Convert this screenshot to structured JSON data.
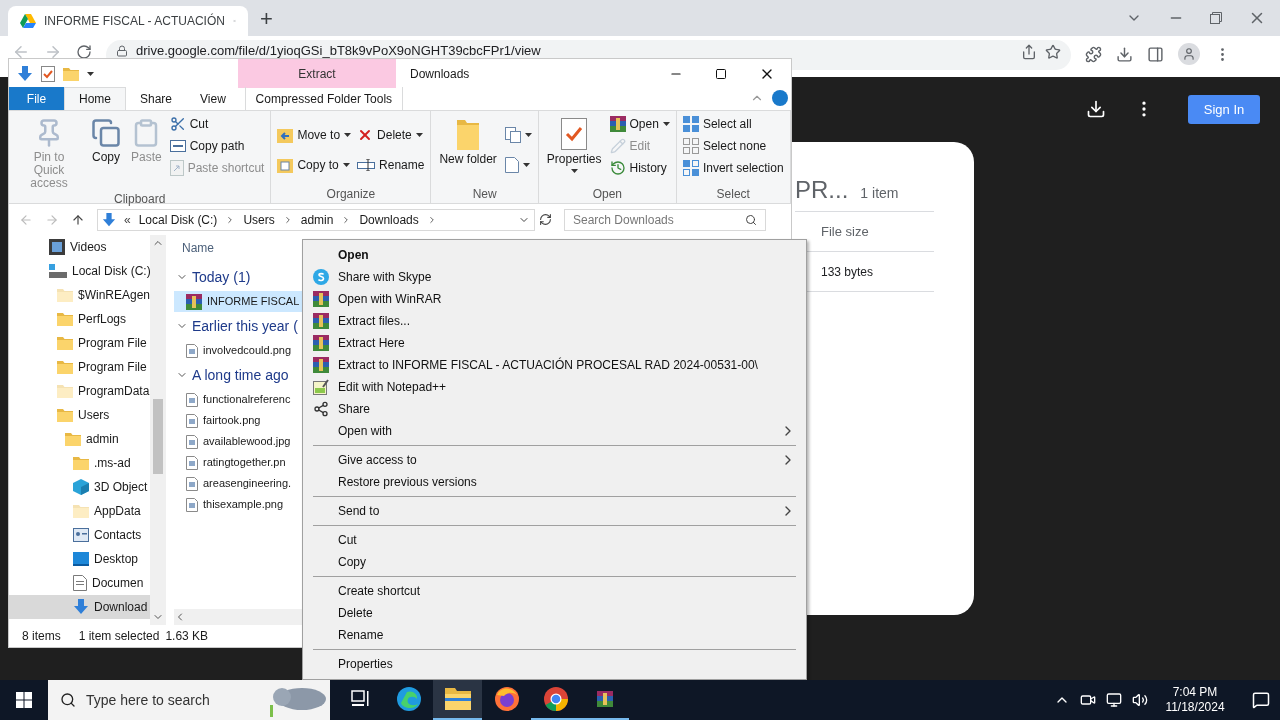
{
  "browser": {
    "tab_title": "INFORME FISCAL - ACTUACIÓN",
    "new_tab": "+",
    "url": "drive.google.com/file/d/1yioqGSi_bT8k9vPoX9oNGHT39cbcFPr1/view",
    "sign_in": "Sign In"
  },
  "drive_card": {
    "title": "PR...",
    "count": "1 item",
    "column": "File size",
    "value": "133 bytes"
  },
  "explorer": {
    "contextual_group": "Extract",
    "title": "Downloads",
    "ribbon_tabs": [
      {
        "label": "File",
        "kind": "file",
        "selected": false
      },
      {
        "label": "Home",
        "kind": "tab",
        "selected": true
      },
      {
        "label": "Share",
        "kind": "tab",
        "selected": false
      },
      {
        "label": "View",
        "kind": "tab",
        "selected": false
      },
      {
        "label": "Compressed Folder Tools",
        "kind": "contextual",
        "selected": false
      }
    ],
    "ribbon_groups": [
      {
        "label": "Clipboard",
        "columns": [
          {
            "kind": "large",
            "items": [
              {
                "label": "Pin to Quick access",
                "disabled": true,
                "dropdown": false
              }
            ]
          },
          {
            "kind": "large",
            "items": [
              {
                "label": "Copy",
                "disabled": false,
                "dropdown": false
              }
            ]
          },
          {
            "kind": "large",
            "items": [
              {
                "label": "Paste",
                "disabled": true,
                "dropdown": false
              }
            ]
          },
          {
            "kind": "stack",
            "items": [
              {
                "label": "Cut",
                "disabled": false,
                "dropdown": false
              },
              {
                "label": "Copy path",
                "disabled": false,
                "dropdown": false
              },
              {
                "label": "Paste shortcut",
                "disabled": true,
                "dropdown": false
              }
            ]
          }
        ]
      },
      {
        "label": "Organize",
        "columns": [
          {
            "kind": "stack",
            "items": [
              {
                "label": "Move to",
                "disabled": false,
                "dropdown": true
              },
              {
                "label": "Copy to",
                "disabled": false,
                "dropdown": true
              }
            ]
          },
          {
            "kind": "stack",
            "items": [
              {
                "label": "Delete",
                "disabled": false,
                "dropdown": true
              },
              {
                "label": "Rename",
                "disabled": false,
                "dropdown": false
              }
            ]
          }
        ]
      },
      {
        "label": "New",
        "columns": [
          {
            "kind": "large",
            "items": [
              {
                "label": "New folder",
                "disabled": false,
                "dropdown": false
              }
            ]
          },
          {
            "kind": "stack",
            "items": [
              {
                "disabled": false,
                "dropdown": true
              },
              {
                "disabled": false,
                "dropdown": true
              }
            ]
          }
        ]
      },
      {
        "label": "Open",
        "columns": [
          {
            "kind": "large",
            "items": [
              {
                "label": "Properties",
                "disabled": false,
                "dropdown": true
              }
            ]
          },
          {
            "kind": "stack",
            "items": [
              {
                "label": "Open",
                "disabled": false,
                "dropdown": true
              },
              {
                "label": "Edit",
                "disabled": true,
                "dropdown": false
              },
              {
                "label": "History",
                "disabled": false,
                "dropdown": false
              }
            ]
          }
        ]
      },
      {
        "label": "Select",
        "columns": [
          {
            "kind": "stack",
            "items": [
              {
                "label": "Select all",
                "disabled": false,
                "dropdown": false
              },
              {
                "label": "Select none",
                "disabled": false,
                "dropdown": false
              },
              {
                "label": "Invert selection",
                "disabled": false,
                "dropdown": false
              }
            ]
          }
        ]
      }
    ],
    "address": {
      "overflow": "«",
      "crumbs": [
        "Local Disk (C:)",
        "Users",
        "admin",
        "Downloads"
      ],
      "search_placeholder": "Search Downloads"
    },
    "nav": [
      {
        "label": "Videos",
        "kind": "videos",
        "hidden": false,
        "selected": false
      },
      {
        "label": "Local Disk (C:)",
        "kind": "drive",
        "hidden": false,
        "selected": false,
        "children": [
          {
            "label": "$WinREAgen",
            "kind": "folder",
            "hidden": true,
            "selected": false
          },
          {
            "label": "PerfLogs",
            "kind": "folder",
            "hidden": false,
            "selected": false
          },
          {
            "label": "Program File",
            "kind": "folder",
            "hidden": false,
            "selected": false
          },
          {
            "label": "Program File",
            "kind": "folder",
            "hidden": false,
            "selected": false
          },
          {
            "label": "ProgramData",
            "kind": "folder",
            "hidden": true,
            "selected": false
          },
          {
            "label": "Users",
            "kind": "folder",
            "hidden": false,
            "selected": false,
            "children": [
              {
                "label": "admin",
                "kind": "folder",
                "hidden": false,
                "selected": false,
                "children": [
                  {
                    "label": ".ms-ad",
                    "kind": "folder",
                    "hidden": false,
                    "selected": false
                  },
                  {
                    "label": "3D Object",
                    "kind": "cube",
                    "hidden": false,
                    "selected": false
                  },
                  {
                    "label": "AppData",
                    "kind": "folder",
                    "hidden": true,
                    "selected": false
                  },
                  {
                    "label": "Contacts",
                    "kind": "contacts",
                    "hidden": false,
                    "selected": false
                  },
                  {
                    "label": "Desktop",
                    "kind": "desktop",
                    "hidden": false,
                    "selected": false
                  },
                  {
                    "label": "Documen",
                    "kind": "documents",
                    "hidden": false,
                    "selected": false
                  },
                  {
                    "label": "Download",
                    "kind": "downloads",
                    "hidden": false,
                    "selected": true
                  }
                ]
              }
            ]
          }
        ]
      }
    ],
    "name_column": "Name",
    "groups": [
      {
        "label": "Today (1)",
        "files": [
          {
            "name": "INFORME FISCAL",
            "kind": "archive",
            "selected": true
          }
        ]
      },
      {
        "label": "Earlier this year (",
        "files": [
          {
            "name": "involvedcould.png",
            "kind": "image",
            "selected": false
          }
        ]
      },
      {
        "label": "A long time ago",
        "files": [
          {
            "name": "functionalreferenc",
            "kind": "image",
            "selected": false
          },
          {
            "name": "fairtook.png",
            "kind": "image",
            "selected": false
          },
          {
            "name": "availablewood.jpg",
            "kind": "image",
            "selected": false
          },
          {
            "name": "ratingtogether.pn",
            "kind": "image",
            "selected": false
          },
          {
            "name": "areasengineering.",
            "kind": "image",
            "selected": false
          },
          {
            "name": "thisexample.png",
            "kind": "image",
            "selected": false
          }
        ]
      }
    ],
    "status": {
      "count": "8 items",
      "selection": "1 item selected",
      "size": "1.63 KB"
    }
  },
  "context_menu": [
    {
      "kind": "plain",
      "label": "Open",
      "default": true,
      "submenu": false
    },
    {
      "kind": "skype",
      "label": "Share with Skype",
      "default": false,
      "submenu": false
    },
    {
      "kind": "archive",
      "label": "Open with WinRAR",
      "default": false,
      "submenu": false
    },
    {
      "kind": "archive",
      "label": "Extract files...",
      "default": false,
      "submenu": false
    },
    {
      "kind": "archive",
      "label": "Extract Here",
      "default": false,
      "submenu": false
    },
    {
      "kind": "archive",
      "label": "Extract to INFORME FISCAL - ACTUACIÓN PROCESAL RAD 2024-00531-00\\",
      "default": false,
      "submenu": false
    },
    {
      "kind": "notepad",
      "label": "Edit with Notepad++",
      "default": false,
      "submenu": false
    },
    {
      "kind": "share",
      "label": "Share",
      "default": false,
      "submenu": false
    },
    {
      "kind": "plain",
      "label": "Open with",
      "default": false,
      "submenu": true
    },
    {
      "kind": "separator"
    },
    {
      "kind": "plain",
      "label": "Give access to",
      "default": false,
      "submenu": true
    },
    {
      "kind": "plain",
      "label": "Restore previous versions",
      "default": false,
      "submenu": false
    },
    {
      "kind": "separator"
    },
    {
      "kind": "plain",
      "label": "Send to",
      "default": false,
      "submenu": true
    },
    {
      "kind": "separator"
    },
    {
      "kind": "plain",
      "label": "Cut",
      "default": false,
      "submenu": false
    },
    {
      "kind": "plain",
      "label": "Copy",
      "default": false,
      "submenu": false
    },
    {
      "kind": "separator"
    },
    {
      "kind": "plain",
      "label": "Create shortcut",
      "default": false,
      "submenu": false
    },
    {
      "kind": "plain",
      "label": "Delete",
      "default": false,
      "submenu": false
    },
    {
      "kind": "plain",
      "label": "Rename",
      "default": false,
      "submenu": false
    },
    {
      "kind": "separator"
    },
    {
      "kind": "plain",
      "label": "Properties",
      "default": false,
      "submenu": false
    }
  ],
  "taskbar": {
    "search_placeholder": "Type here to search",
    "apps": [
      {
        "kind": "task_view",
        "running": false,
        "active": false
      },
      {
        "kind": "edge",
        "running": false,
        "active": false
      },
      {
        "kind": "explorer",
        "running": true,
        "active": true
      },
      {
        "kind": "firefox",
        "running": false,
        "active": false
      },
      {
        "kind": "chrome",
        "running": true,
        "active": false
      },
      {
        "kind": "archive",
        "running": true,
        "active": false
      }
    ],
    "time": "7:04 PM",
    "date": "11/18/2024"
  }
}
